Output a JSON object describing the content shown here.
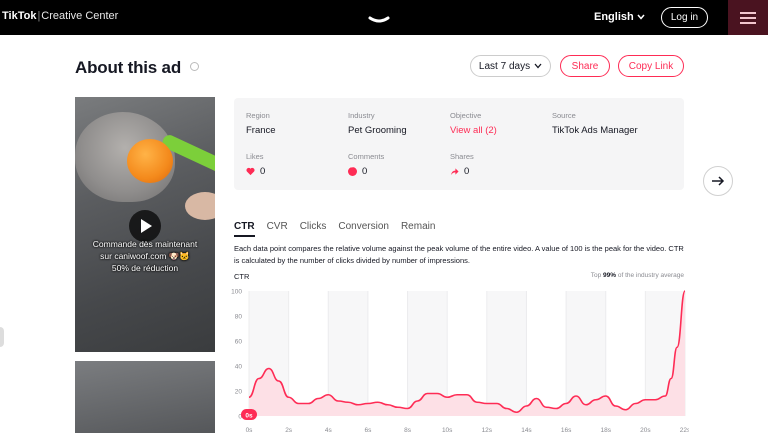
{
  "header": {
    "logo": "TikTok",
    "logo_sub": "Creative Center",
    "language": "English",
    "login_label": "Log in"
  },
  "page": {
    "title": "About this ad",
    "date_range": "Last 7 days",
    "share_label": "Share",
    "copy_link_label": "Copy Link"
  },
  "video": {
    "caption_lines": [
      "Commande dès maintenant",
      "sur caniwoof.com 🐶🐱",
      "50% de réduction"
    ]
  },
  "stats": {
    "region_label": "Region",
    "region": "France",
    "industry_label": "Industry",
    "industry": "Pet Grooming",
    "objective_label": "Objective",
    "objective": "View all (2)",
    "source_label": "Source",
    "source": "TikTok Ads Manager",
    "likes_label": "Likes",
    "likes": "0",
    "comments_label": "Comments",
    "comments": "0",
    "shares_label": "Shares",
    "shares": "0"
  },
  "tabs": [
    "CTR",
    "CVR",
    "Clicks",
    "Conversion",
    "Remain"
  ],
  "active_tab": "CTR",
  "chart_description": "Each data point compares the relative volume against the peak volume of the entire video. A value of 100 is the peak for the video. CTR is calculated by the number of clicks divided by number of impressions.",
  "top_note": {
    "prefix": "Top ",
    "pct": "99%",
    "suffix": " of the industry average"
  },
  "colors": {
    "accent": "#fe2c55",
    "area_fill": "#fde0e6",
    "grid_band": "#f7f7f8"
  },
  "chart_data": {
    "type": "area",
    "title": "CTR",
    "ylim": [
      0,
      100
    ],
    "yticks": [
      0,
      20,
      40,
      60,
      80,
      100
    ],
    "x_ticks": [
      "0s",
      "2s",
      "4s",
      "6s",
      "8s",
      "10s",
      "12s",
      "14s",
      "16s",
      "18s",
      "20s",
      "22s"
    ],
    "xlim": [
      0,
      22
    ],
    "grid": true,
    "marker_label": "0s",
    "series": [
      {
        "x": [
          0,
          0.5,
          1,
          1.5,
          2,
          2.5,
          3,
          3.5,
          4,
          4.5,
          5,
          5.5,
          6,
          6.5,
          7,
          7.5,
          8,
          8.5,
          9,
          9.5,
          10,
          10.5,
          11,
          11.5,
          12,
          12.5,
          13,
          13.5,
          14,
          14.5,
          15,
          15.5,
          16,
          16.5,
          17,
          17.5,
          18,
          18.5,
          19,
          19.5,
          20,
          20.5,
          21,
          21.3,
          21.6,
          22
        ],
        "y": [
          15,
          30,
          38,
          28,
          15,
          10,
          10,
          14,
          17,
          12,
          11,
          9,
          10,
          11,
          9,
          7,
          6,
          12,
          18,
          18,
          15,
          17,
          17,
          11,
          10,
          10,
          6,
          3,
          8,
          14,
          7,
          6,
          10,
          16,
          9,
          13,
          16,
          8,
          5,
          10,
          13,
          13,
          16,
          30,
          55,
          100
        ]
      }
    ]
  }
}
